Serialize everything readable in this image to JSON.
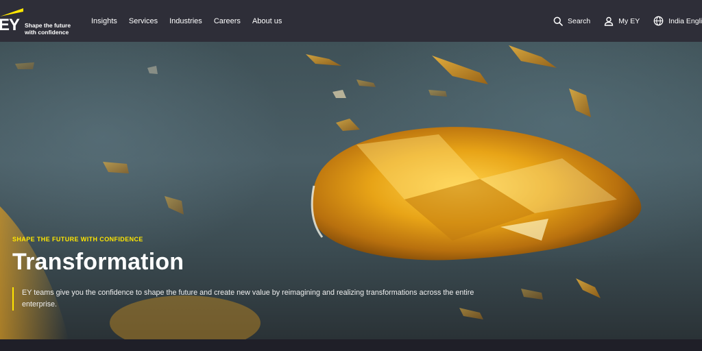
{
  "brand": {
    "logo_text": "EY",
    "tagline": "Shape the future with confidence",
    "accent_color": "#ffe600"
  },
  "nav": {
    "items": [
      {
        "label": "Insights"
      },
      {
        "label": "Services"
      },
      {
        "label": "Industries"
      },
      {
        "label": "Careers"
      },
      {
        "label": "About us"
      }
    ]
  },
  "utility": {
    "search_label": "Search",
    "search_icon": "search-icon",
    "account_label": "My EY",
    "account_icon": "user-icon",
    "locale_label": "India English",
    "locale_icon": "globe-icon"
  },
  "hero": {
    "eyebrow": "SHAPE THE FUTURE WITH CONFIDENCE",
    "title": "Transformation",
    "description": "EY teams give you the confidence to shape the future and create new value by reimagining and realizing transformations across the entire enterprise.",
    "image_subject": "amber gemstone shards floating on teal background"
  }
}
